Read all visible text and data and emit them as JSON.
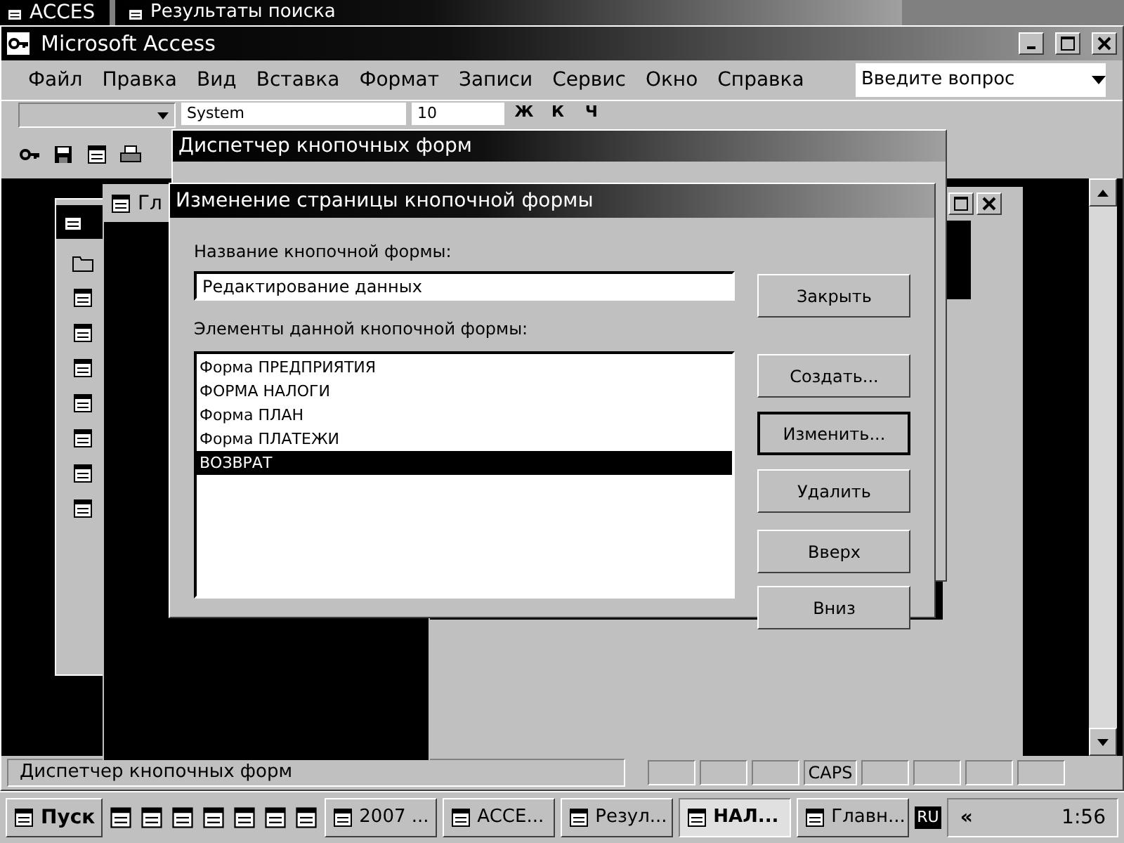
{
  "background_windows": [
    {
      "title": "ACCES"
    },
    {
      "title": "Результаты поиска"
    }
  ],
  "window": {
    "title": "Microsoft Access"
  },
  "menu": [
    "Файл",
    "Правка",
    "Вид",
    "Вставка",
    "Формат",
    "Записи",
    "Сервис",
    "Окно",
    "Справка"
  ],
  "help_box": {
    "placeholder": "Введите вопрос"
  },
  "toolbar": {
    "font_name": "System",
    "font_size": "10",
    "format_buttons": [
      "Ж",
      "К",
      "Ч"
    ]
  },
  "database_window": {
    "title": "Гл"
  },
  "switchboard_manager": {
    "title": "Диспетчер кнопочных форм"
  },
  "dialog": {
    "title": "Изменение страницы кнопочной формы",
    "name_label": "Название кнопочной формы:",
    "name_value": "Редактирование данных",
    "items_label": "Элементы данной кнопочной формы:",
    "items": [
      {
        "label": "Форма ПРЕДПРИЯТИЯ",
        "selected": false
      },
      {
        "label": "ФОРМА НАЛОГИ",
        "selected": false
      },
      {
        "label": "Форма ПЛАН",
        "selected": false
      },
      {
        "label": "Форма ПЛАТЕЖИ",
        "selected": false
      },
      {
        "label": "ВОЗВРАТ",
        "selected": true
      }
    ],
    "buttons": [
      {
        "label": "Закрыть",
        "focused": false
      },
      {
        "label": "Создать...",
        "focused": false
      },
      {
        "label": "Изменить...",
        "focused": true
      },
      {
        "label": "Удалить",
        "focused": false
      },
      {
        "label": "Вверх",
        "focused": false
      },
      {
        "label": "Вниз",
        "focused": false
      }
    ]
  },
  "status_bar": {
    "text": "Диспетчер кнопочных форм",
    "indicator": "CAPS"
  },
  "taskbar": {
    "start": "Пуск",
    "tasks": [
      {
        "label": "2007 ...",
        "selected": false
      },
      {
        "label": "ACCE...",
        "selected": false
      },
      {
        "label": "Резул...",
        "selected": false
      },
      {
        "label": "НАЛ...",
        "selected": true
      },
      {
        "label": "Главн...",
        "selected": false
      }
    ],
    "language": "RU",
    "expand": "«",
    "clock": "1:56"
  }
}
